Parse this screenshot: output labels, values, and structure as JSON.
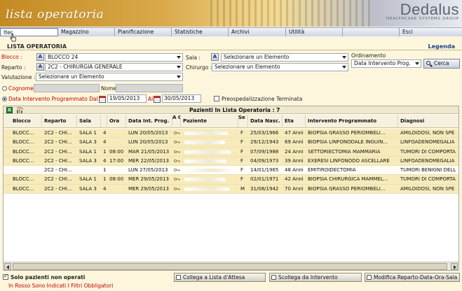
{
  "banner": {
    "app_title": "lista operatoria",
    "logo_name": "Dedalus",
    "logo_sub": "HEALTHCARE SYSTEMS GROUP"
  },
  "menu": [
    "Iter",
    "Magazzino",
    "Pianificazione",
    "Statistiche",
    "Archivi",
    "Utilità",
    "",
    "Esci"
  ],
  "section_title": "LISTA OPERATORIA",
  "legenda": "Legenda",
  "filters": {
    "blocco_label": "Blocco :",
    "blocco_value": "BLOCCO 24",
    "reparto_label": "Reparto :",
    "reparto_value": "2C2 - CHIRURGIA GENERALE",
    "valutazione_label": "Valutazione :",
    "valutazione_value": "Selezionare un Elemento",
    "sala_label": "Sala :",
    "sala_value": "Selezionare un Elemento",
    "chirurgo_label": "Chirurgo :",
    "chirurgo_value": "Selezionare un Elemento",
    "ordinamento_label": "Ordinamento",
    "ordinamento_value": "Data Intervento Prog.",
    "cerca_label": "Cerca",
    "cognome_label": "Cognome",
    "nome_label": "Nome",
    "data_label": "Data Intervento Programmato Dal",
    "data_dal": "19/05/2013",
    "al_label": "Al",
    "data_al": "30/05/2013",
    "preosp_label": "Preospedalizzazione Terminata",
    "a_button": "A"
  },
  "grid": {
    "caption": "Pazienti In Lista Operatoria : 7",
    "xls_icon": "X",
    "headers": [
      "Blocco",
      "Reparto",
      "Sala",
      "",
      "Ora",
      "Data Int. Prog.",
      "A C C",
      "Paziente",
      "Se X",
      "Data Nasc.",
      "Eta",
      "Intervento Programmato",
      "Diagnosi"
    ],
    "rows": [
      {
        "blocco": "BLOCC...",
        "reparto": "2C2 - CHI...",
        "sala": "SALA 1",
        "n": "4",
        "ora": "",
        "data": "LUN 20/05/2013",
        "sesso": "F",
        "nascita": "25/03/1966",
        "eta": "47 Anni",
        "intervento": "BIOPSIA GRASSO PERIOMBELI...",
        "diagnosi": "AMILOIDOSI, NON SPE"
      },
      {
        "blocco": "BLOCC...",
        "reparto": "2C2 - CHI...",
        "sala": "SALA 3",
        "n": "4",
        "ora": "",
        "data": "LUN 20/05/2013",
        "sesso": "F",
        "nascita": "29/12/1943",
        "eta": "69 Anni",
        "intervento": "BIOPSIA LINFONODALE INGUIN...",
        "diagnosi": "LINFOADENOMEGALIA"
      },
      {
        "blocco": "BLOCC...",
        "reparto": "2C2 - CHI...",
        "sala": "SALA 1",
        "n": "1",
        "ora": "08:00",
        "data": "MAR 21/05/2013",
        "sesso": "F",
        "nascita": "07/09/1988",
        "eta": "24 Anni",
        "intervento": "SETTORIECTOMIA MAMMARIA",
        "diagnosi": "TUMORI DI COMPORTA"
      },
      {
        "blocco": "BLOCC...",
        "reparto": "2C2 - CHI...",
        "sala": "SALA 3",
        "n": "4",
        "ora": "17:00",
        "data": "MER 22/05/2013",
        "sesso": "F",
        "nascita": "04/09/1973",
        "eta": "39 Anni",
        "intervento": "EXERESI LINFONODO ASCELLARE",
        "diagnosi": "LINFOADENOMEGALIA"
      },
      {
        "blocco": "",
        "reparto": "2C2 - CHI...",
        "sala": "",
        "n": "1",
        "ora": "",
        "data": "LUN 27/05/2013",
        "sesso": "F",
        "nascita": "14/01/1965",
        "eta": "48 Anni",
        "intervento": "EMITIROIDECTOMIA",
        "diagnosi": "TUMORI BENIGNI DELL"
      },
      {
        "blocco": "BLOCC...",
        "reparto": "2C2 - CHI...",
        "sala": "SALA 1",
        "n": "1",
        "ora": "08:00",
        "data": "MER 29/05/2013",
        "sesso": "F",
        "nascita": "02/01/1971",
        "eta": "42 Anni",
        "intervento": "BIOPSIA CHIRURGICA MAMMEL...",
        "diagnosi": "TUMORI DI COMPORTA"
      },
      {
        "blocco": "BLOCC...",
        "reparto": "2C2 - CHI...",
        "sala": "SALA 3",
        "n": "4",
        "ora": "",
        "data": "MER 29/05/2013",
        "sesso": "M",
        "nascita": "31/08/1942",
        "eta": "70 Anni",
        "intervento": "BIOPSIA GRASSO PERIOMBELI...",
        "diagnosi": "AMILOIDOSI, NON SPE"
      }
    ]
  },
  "footer": {
    "solo_label": "Solo pazienti non operati",
    "note": "In Rosso Sono Indicati I Filtri Obbligatori",
    "btn_collega": "Collega a Lista d'Attesa",
    "btn_scollega": "Scollega da Intervento",
    "btn_modifica": "Modifica Reparto-Data-Ora-Sala"
  },
  "colors": {
    "row_highlight": "#f7ebb9",
    "required_label": "#c00000",
    "legenda": "#1f3f86"
  }
}
